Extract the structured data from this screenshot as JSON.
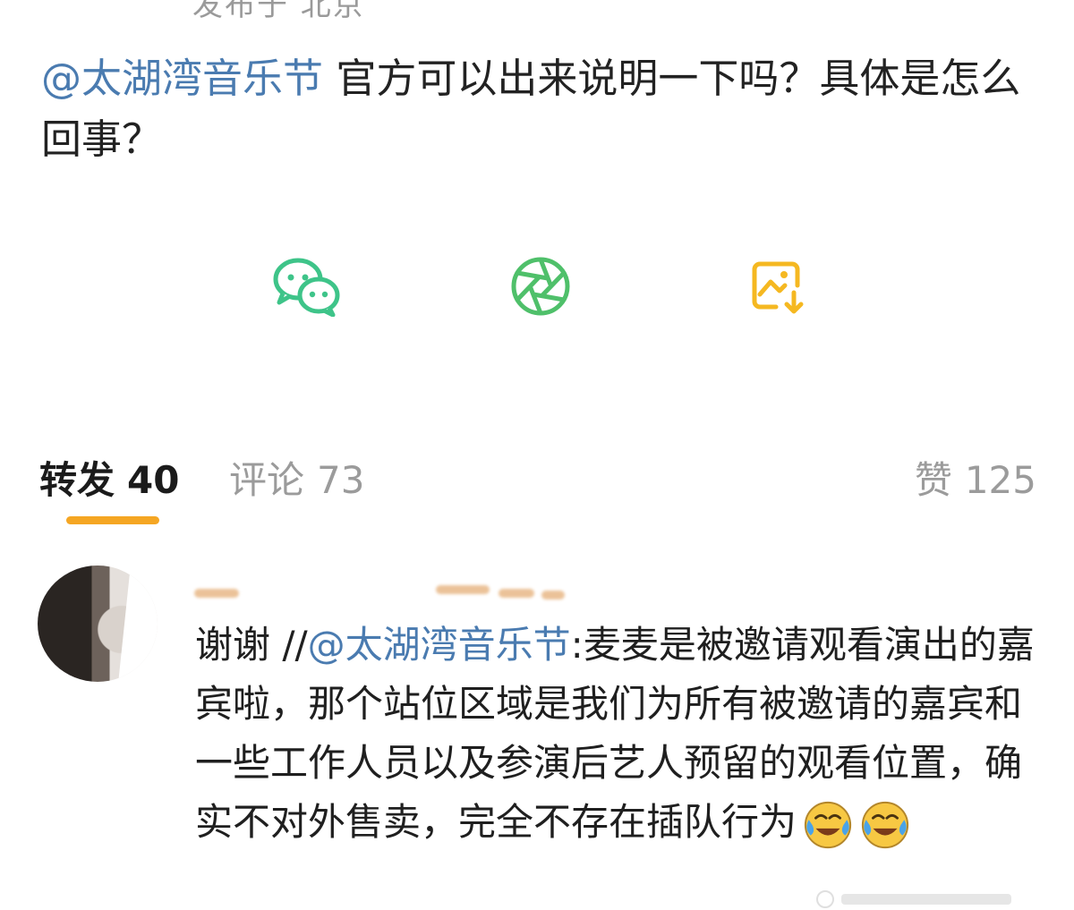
{
  "post": {
    "location": "发布于 北京",
    "mention": "@太湖湾音乐节",
    "text": " 官方可以出来说明一下吗？具体是怎么回事？"
  },
  "share": {
    "wechat_icon": "wechat-icon",
    "moments_icon": "moments-icon",
    "save_icon": "save-image-icon",
    "colors": {
      "wechat": "#3ec489",
      "moments": "#4fc06a",
      "save": "#f5b821"
    }
  },
  "tabs": {
    "repost_label": "转发",
    "repost_count": "40",
    "comment_label": "评论",
    "comment_count": "73",
    "like_label": "赞",
    "like_count": "125",
    "active_color": "#f5a623"
  },
  "comment": {
    "prefix": "谢谢 //",
    "mention": "@太湖湾音乐节",
    "text": ":麦麦是被邀请观看演出的嘉宾啦，那个站位区域是我们为所有被邀请的嘉宾和一些工作人员以及参演后艺人预留的观看位置，确实不对外售卖，完全不存在插队行为",
    "emojis": [
      "laugh-cry-emoji",
      "laugh-cry-emoji"
    ]
  }
}
